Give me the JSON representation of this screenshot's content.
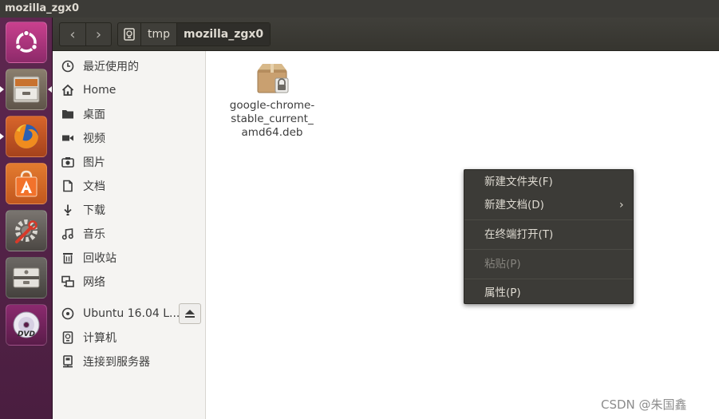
{
  "window": {
    "title": "mozilla_zgx0"
  },
  "launcher": {
    "items": [
      {
        "name": "dash-home",
        "icon": "ubuntu-logo-icon"
      },
      {
        "name": "files",
        "icon": "file-cabinet-icon",
        "active": true
      },
      {
        "name": "firefox",
        "icon": "firefox-icon"
      },
      {
        "name": "software-center",
        "icon": "shopping-bag-icon"
      },
      {
        "name": "system-settings",
        "icon": "gear-wrench-icon"
      },
      {
        "name": "removable-drive",
        "icon": "drive-icon"
      },
      {
        "name": "dvd",
        "icon": "dvd-icon",
        "label": "DVD"
      }
    ]
  },
  "header": {
    "back": "‹",
    "forward": "›",
    "path": [
      {
        "label": "tmp"
      },
      {
        "label": "mozilla_zgx0"
      }
    ]
  },
  "sidebar": {
    "items": [
      {
        "label": "最近使用的",
        "icon": "clock-icon"
      },
      {
        "label": "Home",
        "icon": "home-icon"
      },
      {
        "label": "桌面",
        "icon": "folder-icon"
      },
      {
        "label": "视频",
        "icon": "video-icon"
      },
      {
        "label": "图片",
        "icon": "camera-icon"
      },
      {
        "label": "文档",
        "icon": "document-icon"
      },
      {
        "label": "下载",
        "icon": "download-icon"
      },
      {
        "label": "音乐",
        "icon": "music-icon"
      },
      {
        "label": "回收站",
        "icon": "trash-icon"
      },
      {
        "label": "网络",
        "icon": "network-icon"
      }
    ],
    "devices": [
      {
        "label": "Ubuntu 16.04 L...",
        "icon": "disc-icon",
        "eject_icon": "eject-icon"
      },
      {
        "label": "计算机",
        "icon": "computer-icon"
      },
      {
        "label": "连接到服务器",
        "icon": "server-icon"
      }
    ]
  },
  "content": {
    "files": [
      {
        "name": "google-chrome-stable_current_amd64.deb",
        "name_lines": [
          "google-chrome-",
          "stable_current_",
          "amd64.deb"
        ],
        "icon": "package-locked-icon"
      }
    ]
  },
  "context_menu": {
    "items": [
      {
        "label": "新建文件夹(F)"
      },
      {
        "label": "新建文档(D)",
        "submenu_arrow": "›"
      },
      {
        "label": "在终端打开(T)"
      },
      {
        "label": "粘贴(P)",
        "disabled": true
      },
      {
        "label": "属性(P)"
      }
    ]
  },
  "watermark": "CSDN @朱国鑫",
  "colors": {
    "titlebar": "#3c3b37",
    "launcher": "#5e2750",
    "sidebar": "#f5f4f2",
    "menu": "#3c3b37",
    "menu_text": "#dfdbd2"
  }
}
